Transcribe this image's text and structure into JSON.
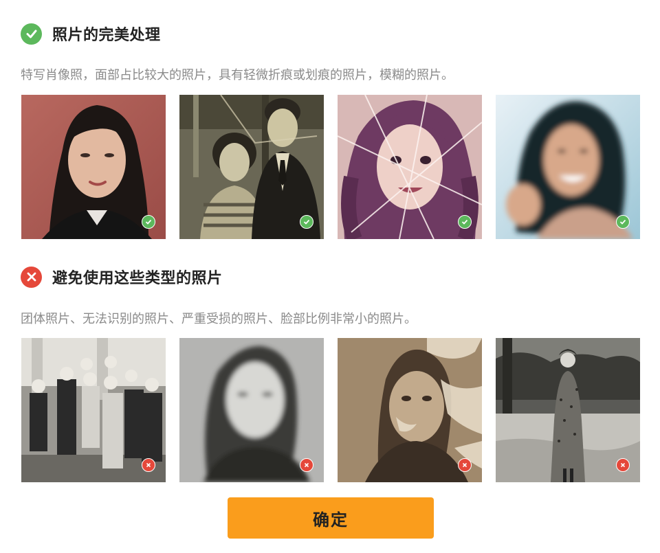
{
  "colors": {
    "good": "#5cb85c",
    "bad": "#e5483a",
    "button": "#fa9d1c"
  },
  "good_section": {
    "icon": "check-circle-icon",
    "title": "照片的完美处理",
    "description": "特写肖像照，面部占比较大的照片，具有轻微折痕或划痕的照片，模糊的照片。",
    "photos": [
      {
        "name": "photo-closeup-portrait",
        "badge_icon": "check-badge-icon"
      },
      {
        "name": "photo-couple-vintage",
        "badge_icon": "check-badge-icon"
      },
      {
        "name": "photo-creased-girl",
        "badge_icon": "check-badge-icon"
      },
      {
        "name": "photo-blurry-woman",
        "badge_icon": "check-badge-icon"
      }
    ]
  },
  "bad_section": {
    "icon": "x-circle-icon",
    "title": "避免使用这些类型的照片",
    "description": "团体照片、无法识别的照片、严重受损的照片、脸部比例非常小的照片。",
    "photos": [
      {
        "name": "photo-group",
        "badge_icon": "x-badge-icon"
      },
      {
        "name": "photo-unrecognizable",
        "badge_icon": "x-badge-icon"
      },
      {
        "name": "photo-severely-damaged",
        "badge_icon": "x-badge-icon"
      },
      {
        "name": "photo-tiny-face",
        "badge_icon": "x-badge-icon"
      }
    ]
  },
  "confirm_button": {
    "label": "确定"
  }
}
